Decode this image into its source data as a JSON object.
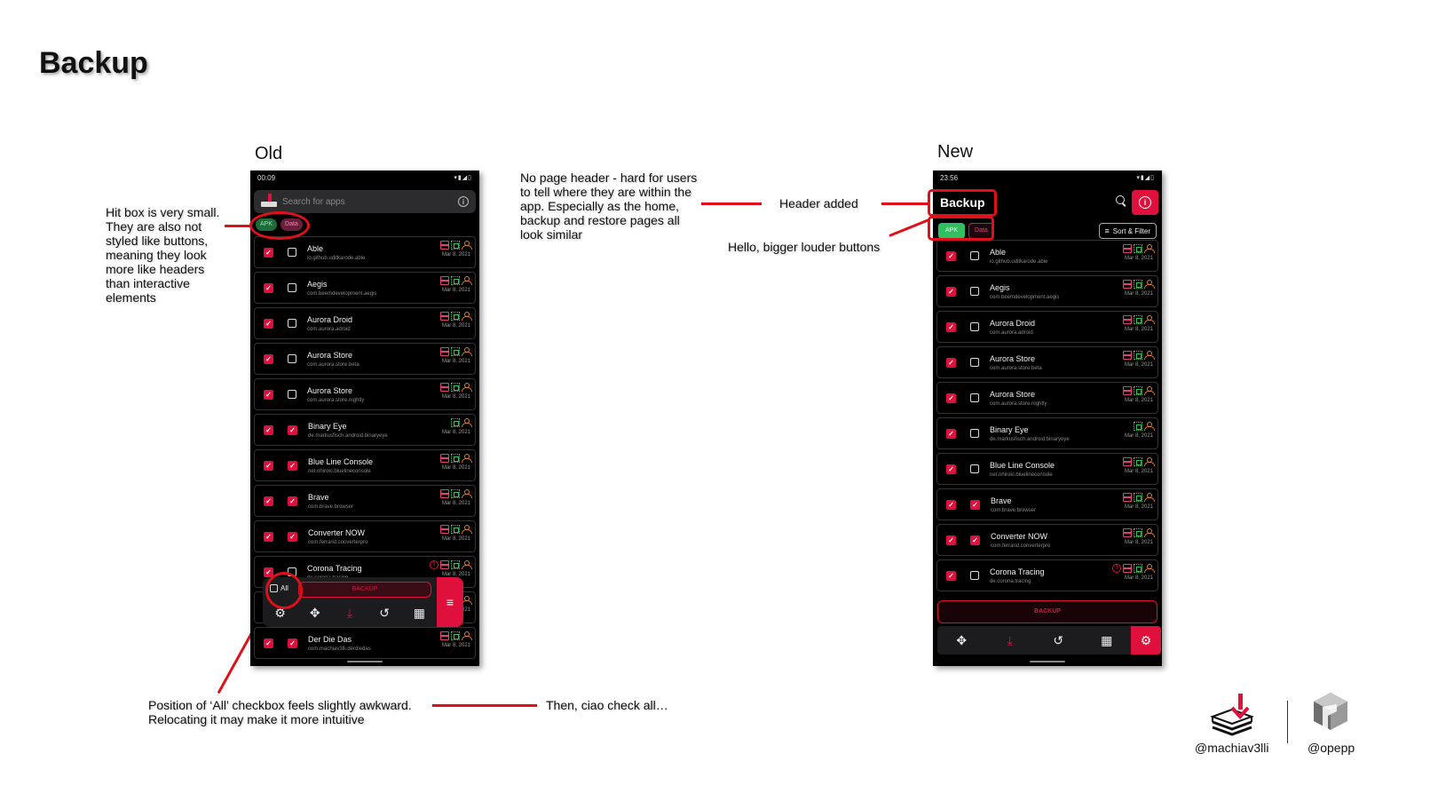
{
  "slide": {
    "title": "Backup",
    "label_old": "Old",
    "label_new": "New"
  },
  "notes": {
    "hit_box": "Hit box is very small. They are also not styled like buttons, meaning they look more like headers than interactive elements",
    "no_header": "No page header - hard for users to tell where they are within the app. Especially as the home, backup and restore pages all look similar",
    "header_added": "Header added",
    "bigger_buttons": "Hello, bigger louder buttons",
    "all_checkbox": "Position of ‘All’ checkbox feels slightly awkward. Relocating it may make it more intuitive",
    "ciao": "Then, ciao check all…"
  },
  "old_phone": {
    "time": "00:09",
    "status_icons": "▾▮◢▯",
    "search_placeholder": "Search for apps",
    "chip_apk": "APK",
    "chip_data": "Data",
    "all_label": "All",
    "backup_label": "BACKUP",
    "apps": [
      {
        "name": "Able",
        "pkg": "io.github.uditkarode.able",
        "date": "Mar 8, 2021",
        "apk": true,
        "cb2": false,
        "warn": false
      },
      {
        "name": "Aegis",
        "pkg": "com.beemdevelopment.aegis",
        "date": "Mar 8, 2021",
        "apk": true,
        "cb2": false,
        "warn": false
      },
      {
        "name": "Aurora Droid",
        "pkg": "com.aurora.adroid",
        "date": "Mar 8, 2021",
        "apk": true,
        "cb2": false,
        "warn": false
      },
      {
        "name": "Aurora Store",
        "pkg": "com.aurora.store.beta",
        "date": "Mar 8, 2021",
        "apk": true,
        "cb2": false,
        "warn": false
      },
      {
        "name": "Aurora Store",
        "pkg": "com.aurora.store.nightly",
        "date": "Mar 8, 2021",
        "apk": true,
        "cb2": false,
        "warn": false
      },
      {
        "name": "Binary Eye",
        "pkg": "de.markusfisch.android.binaryeye",
        "date": "Mar 8, 2021",
        "apk": false,
        "cb2": true,
        "warn": false
      },
      {
        "name": "Blue Line Console",
        "pkg": "net.nhiroki.bluelineconsole",
        "date": "Mar 8, 2021",
        "apk": true,
        "cb2": true,
        "warn": false
      },
      {
        "name": "Brave",
        "pkg": "com.brave.browser",
        "date": "Mar 8, 2021",
        "apk": true,
        "cb2": true,
        "warn": false
      },
      {
        "name": "Converter NOW",
        "pkg": "com.ferrarid.converterpro",
        "date": "Mar 8, 2021",
        "apk": true,
        "cb2": true,
        "warn": false
      },
      {
        "name": "Corona Tracing",
        "pkg": "de.corona.tracing",
        "date": "Mar 8, 2021",
        "apk": true,
        "cb2": false,
        "warn": true
      },
      {
        "name": "",
        "pkg": "",
        "date": "Mar 8, 2021",
        "apk": false,
        "cb2": false,
        "warn": false
      },
      {
        "name": "Der Die Das",
        "pkg": "com.machiav3lli.derdiedas",
        "date": "Mar 8, 2021",
        "apk": true,
        "cb2": true,
        "warn": false
      }
    ]
  },
  "new_phone": {
    "time": "23:56",
    "status_icons": "▾▮◢▯",
    "header_title": "Backup",
    "chip_apk": "APK",
    "chip_data": "Data",
    "sort_label": "Sort & Filter",
    "backup_label": "BACKUP",
    "apps": [
      {
        "name": "Able",
        "pkg": "io.github.uditkarode.able",
        "date": "Mar 8, 2021",
        "apk": true,
        "cb2": false,
        "warn": false
      },
      {
        "name": "Aegis",
        "pkg": "com.beemdevelopment.aegis",
        "date": "Mar 8, 2021",
        "apk": true,
        "cb2": false,
        "warn": false
      },
      {
        "name": "Aurora Droid",
        "pkg": "com.aurora.adroid",
        "date": "Mar 8, 2021",
        "apk": true,
        "cb2": false,
        "warn": false
      },
      {
        "name": "Aurora Store",
        "pkg": "com.aurora.store.beta",
        "date": "Mar 8, 2021",
        "apk": true,
        "cb2": false,
        "warn": false
      },
      {
        "name": "Aurora Store",
        "pkg": "com.aurora.store.nightly",
        "date": "Mar 8, 2021",
        "apk": true,
        "cb2": false,
        "warn": false
      },
      {
        "name": "Binary Eye",
        "pkg": "de.markusfisch.android.binaryeye",
        "date": "Mar 8, 2021",
        "apk": false,
        "cb2": false,
        "warn": false
      },
      {
        "name": "Blue Line Console",
        "pkg": "net.nhiroki.bluelineconsole",
        "date": "Mar 8, 2021",
        "apk": true,
        "cb2": false,
        "warn": false
      },
      {
        "name": "Brave",
        "pkg": "com.brave.browser",
        "date": "Mar 8, 2021",
        "apk": true,
        "cb2": true,
        "warn": false
      },
      {
        "name": "Converter NOW",
        "pkg": "com.ferrarid.converterpro",
        "date": "Mar 8, 2021",
        "apk": true,
        "cb2": true,
        "warn": false
      },
      {
        "name": "Corona Tracing",
        "pkg": "de.corona.tracing",
        "date": "Mar 8, 2021",
        "apk": true,
        "cb2": false,
        "warn": true
      }
    ]
  },
  "footer": {
    "handle_1": "@machiav3lli",
    "handle_2": "@opepp"
  },
  "colors": {
    "accent": "#e0103c",
    "annotation": "#e0101a",
    "apk_green": "#30c060"
  }
}
